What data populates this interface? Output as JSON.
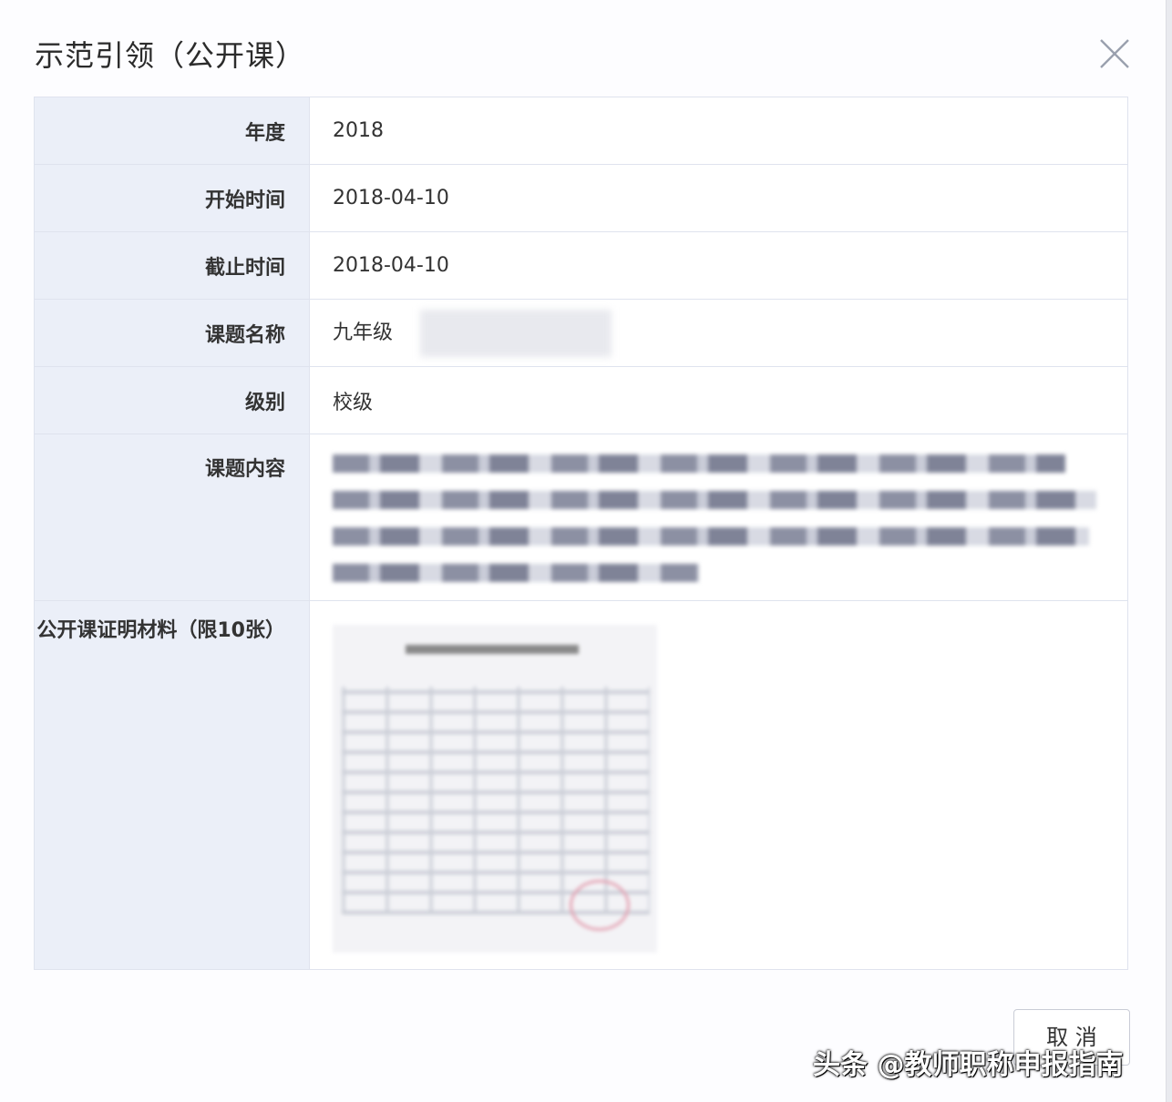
{
  "dialog": {
    "title": "示范引领（公开课）"
  },
  "rows": {
    "year": {
      "label": "年度",
      "value": "2018"
    },
    "start": {
      "label": "开始时间",
      "value": "2018-04-10"
    },
    "end": {
      "label": "截止时间",
      "value": "2018-04-10"
    },
    "topic": {
      "label": "课题名称",
      "value": "九年级"
    },
    "level": {
      "label": "级别",
      "value": "校级"
    },
    "content": {
      "label": "课题内容"
    },
    "material": {
      "label": "公开课证明材料（限10张）"
    }
  },
  "footer": {
    "cancel_label": "取 消"
  },
  "watermark": "头条 @教师职称申报指南",
  "icons": {
    "close": "close-icon"
  },
  "colors": {
    "label_bg": "#ebeff8",
    "border": "#dfe3ee"
  }
}
